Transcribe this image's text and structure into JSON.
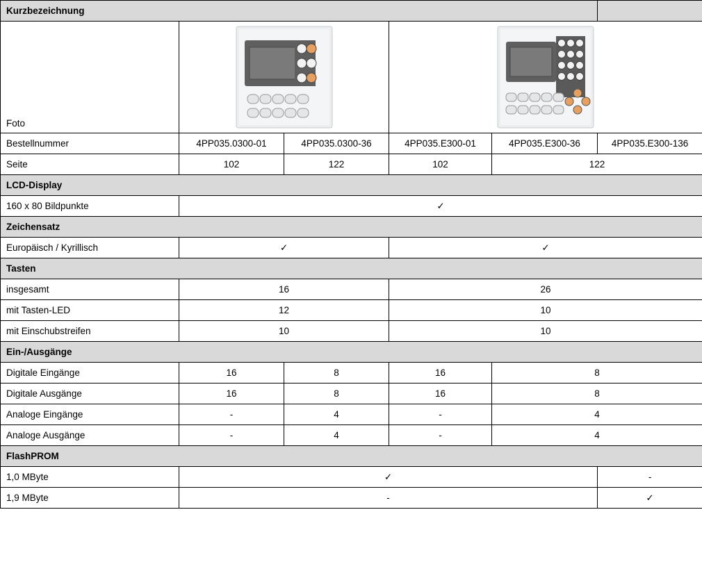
{
  "header": {
    "title": "Kurzbezeichnung"
  },
  "photo": {
    "label": "Foto"
  },
  "order_numbers": {
    "label": "Bestellnummer",
    "values": [
      "4PP035.0300-01",
      "4PP035.0300-36",
      "4PP035.E300-01",
      "4PP035.E300-36",
      "4PP035.E300-136"
    ]
  },
  "page": {
    "label": "Seite",
    "values": [
      "102",
      "122",
      "102",
      "122"
    ]
  },
  "lcd": {
    "section": "LCD-Display",
    "row_label": "160 x 80 Bildpunkte",
    "value": "✓"
  },
  "charset": {
    "section": "Zeichensatz",
    "row_label": "Europäisch / Kyrillisch",
    "values": [
      "✓",
      "✓"
    ]
  },
  "keys": {
    "section": "Tasten",
    "rows": [
      {
        "label": "insgesamt",
        "values": [
          "16",
          "26"
        ]
      },
      {
        "label": "mit Tasten-LED",
        "values": [
          "12",
          "10"
        ]
      },
      {
        "label": "mit Einschubstreifen",
        "values": [
          "10",
          "10"
        ]
      }
    ]
  },
  "io": {
    "section": "Ein-/Ausgänge",
    "rows": [
      {
        "label": "Digitale Eingänge",
        "values": [
          "16",
          "8",
          "16",
          "8"
        ]
      },
      {
        "label": "Digitale Ausgänge",
        "values": [
          "16",
          "8",
          "16",
          "8"
        ]
      },
      {
        "label": "Analoge Eingänge",
        "values": [
          "-",
          "4",
          "-",
          "4"
        ]
      },
      {
        "label": "Analoge Ausgänge",
        "values": [
          "-",
          "4",
          "-",
          "4"
        ]
      }
    ]
  },
  "flash": {
    "section": "FlashPROM",
    "rows": [
      {
        "label": "1,0 MByte",
        "values": [
          "✓",
          "-"
        ]
      },
      {
        "label": "1,9 MByte",
        "values": [
          "-",
          "✓"
        ]
      }
    ]
  },
  "colors": {
    "section_bg": "#d9d9d9",
    "key_orange": "#e8a060",
    "display": "#6e6e6e",
    "bezel": "#5a5a5a"
  }
}
